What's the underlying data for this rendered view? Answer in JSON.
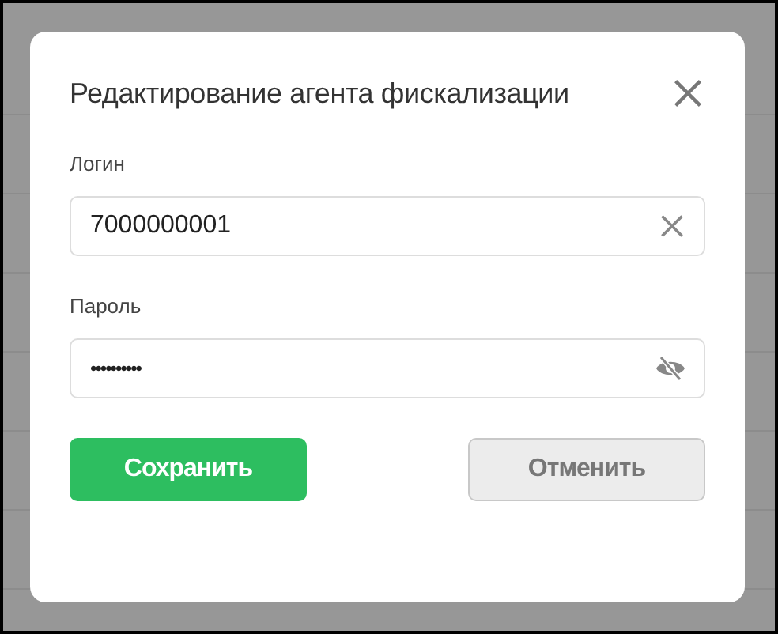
{
  "dialog": {
    "title": "Редактирование агента фискализации"
  },
  "fields": [
    {
      "kind": "text",
      "label": "Логин",
      "value": "7000000001"
    },
    {
      "kind": "password",
      "label": "Пароль",
      "value": "••••••••••"
    }
  ],
  "buttons": [
    {
      "kind": "primary",
      "label": "Сохранить"
    },
    {
      "kind": "secondary",
      "label": "Отменить"
    }
  ]
}
